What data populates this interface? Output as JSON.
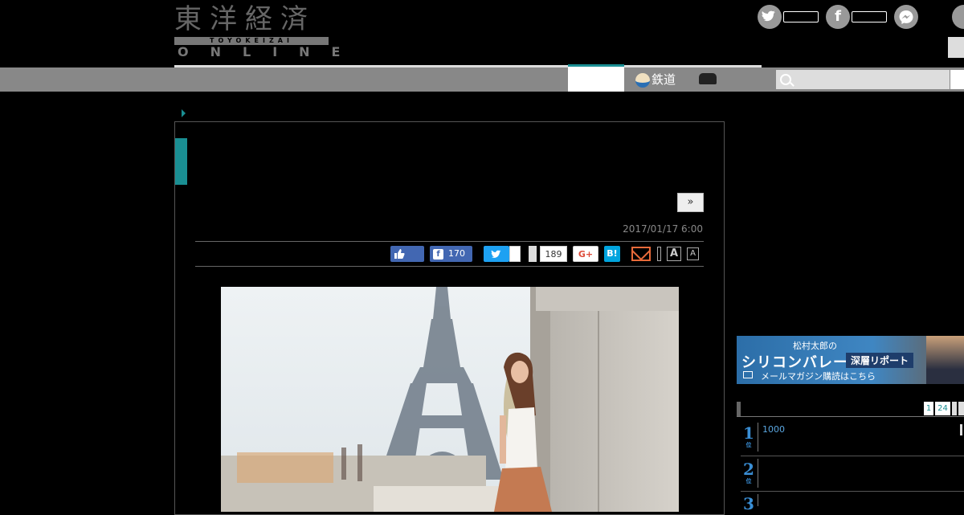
{
  "header": {
    "logo_kanji": "東洋経済",
    "logo_romaji": "TOYOKEIZAI",
    "logo_online": "ONLINE",
    "social": [
      "twitter-icon",
      "facebook-icon",
      "messenger-icon"
    ]
  },
  "nav": {
    "rail_label": "鉄道",
    "search_placeholder": ""
  },
  "article": {
    "next_label": "»",
    "date": "2017/01/17 6:00",
    "share": {
      "facebook_share_count": "170",
      "pocket_count": "189",
      "gplus_label": "G+",
      "hatena_label": "B!",
      "font_large": "A",
      "font_small": "A"
    }
  },
  "sidebar": {
    "banner": {
      "author": "松村太郎の",
      "title": "シリコンバレー",
      "tag": "深層リポート",
      "cta": "メールマガジン購読はこちら"
    },
    "ranking": {
      "tabs": [
        "1",
        "24"
      ],
      "items": [
        {
          "rank": "1",
          "unit": "位",
          "text": "1000"
        },
        {
          "rank": "2",
          "unit": "位",
          "text": ""
        },
        {
          "rank": "3",
          "unit": "位",
          "text": ""
        }
      ]
    }
  },
  "colors": {
    "accent": "#1a8f93",
    "facebook": "#4267b2",
    "twitter": "#1da1f2",
    "hatena": "#00a4de",
    "mail": "#e86a3a"
  }
}
